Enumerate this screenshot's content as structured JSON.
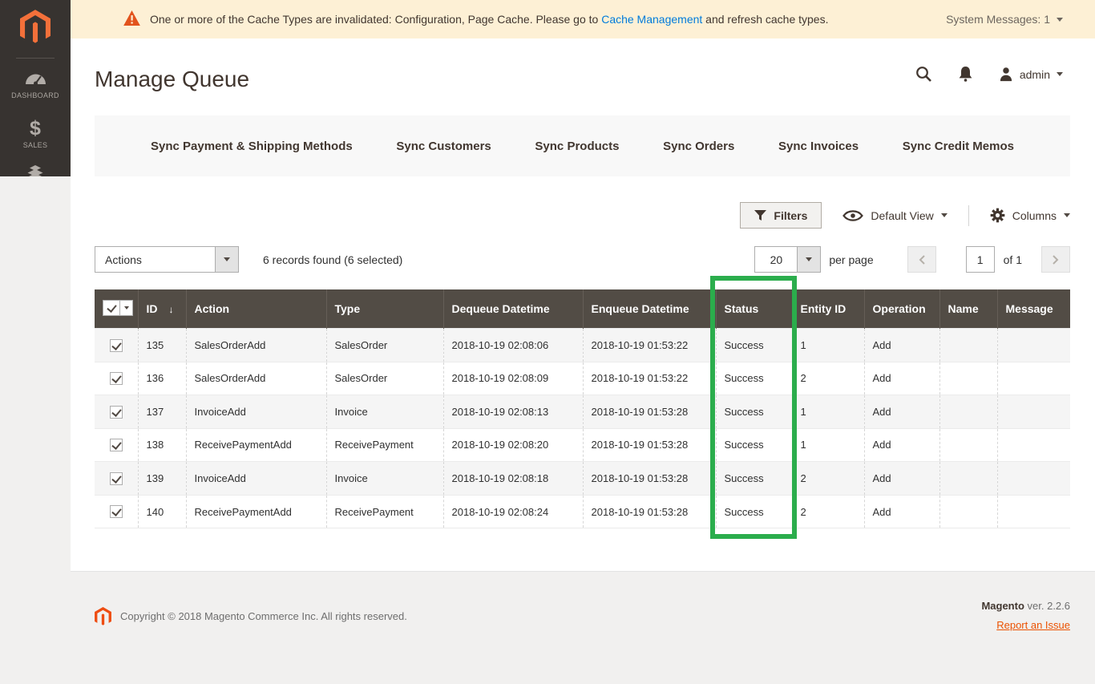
{
  "notice_bar": {
    "message_prefix": "One or more of the Cache Types are invalidated: Configuration, Page Cache. Please go to ",
    "link_text": "Cache Management",
    "message_suffix": " and refresh cache types.",
    "system_messages": "System Messages: 1"
  },
  "sidebar": {
    "items": [
      {
        "label": "DASHBOARD",
        "icon": "dashboard-gauge-icon"
      },
      {
        "label": "SALES",
        "icon": "dollar-icon"
      }
    ]
  },
  "header": {
    "title": "Manage Queue",
    "username": "admin"
  },
  "tabs": [
    {
      "label": "Sync Payment & Shipping Methods"
    },
    {
      "label": "Sync Customers"
    },
    {
      "label": "Sync Products"
    },
    {
      "label": "Sync Orders"
    },
    {
      "label": "Sync Invoices"
    },
    {
      "label": "Sync Credit Memos"
    }
  ],
  "toolbar": {
    "filters_label": "Filters",
    "view_label": "Default View",
    "columns_label": "Columns",
    "actions_label": "Actions",
    "records_summary": "6 records found (6 selected)",
    "per_page_value": "20",
    "per_page_label": "per page",
    "current_page": "1",
    "of_label": "of 1"
  },
  "grid": {
    "sort_icon": "↓",
    "columns": [
      "ID",
      "Action",
      "Type",
      "Dequeue Datetime",
      "Enqueue Datetime",
      "Status",
      "Entity ID",
      "Operation",
      "Name",
      "Message"
    ],
    "rows": [
      {
        "id": "135",
        "action": "SalesOrderAdd",
        "type": "SalesOrder",
        "dequeue": "2018-10-19 02:08:06",
        "enqueue": "2018-10-19 01:53:22",
        "status": "Success",
        "entity_id": "1",
        "operation": "Add",
        "name": "",
        "message": ""
      },
      {
        "id": "136",
        "action": "SalesOrderAdd",
        "type": "SalesOrder",
        "dequeue": "2018-10-19 02:08:09",
        "enqueue": "2018-10-19 01:53:22",
        "status": "Success",
        "entity_id": "2",
        "operation": "Add",
        "name": "",
        "message": ""
      },
      {
        "id": "137",
        "action": "InvoiceAdd",
        "type": "Invoice",
        "dequeue": "2018-10-19 02:08:13",
        "enqueue": "2018-10-19 01:53:28",
        "status": "Success",
        "entity_id": "1",
        "operation": "Add",
        "name": "",
        "message": ""
      },
      {
        "id": "138",
        "action": "ReceivePaymentAdd",
        "type": "ReceivePayment",
        "dequeue": "2018-10-19 02:08:20",
        "enqueue": "2018-10-19 01:53:28",
        "status": "Success",
        "entity_id": "1",
        "operation": "Add",
        "name": "",
        "message": ""
      },
      {
        "id": "139",
        "action": "InvoiceAdd",
        "type": "Invoice",
        "dequeue": "2018-10-19 02:08:18",
        "enqueue": "2018-10-19 01:53:28",
        "status": "Success",
        "entity_id": "2",
        "operation": "Add",
        "name": "",
        "message": ""
      },
      {
        "id": "140",
        "action": "ReceivePaymentAdd",
        "type": "ReceivePayment",
        "dequeue": "2018-10-19 02:08:24",
        "enqueue": "2018-10-19 01:53:28",
        "status": "Success",
        "entity_id": "2",
        "operation": "Add",
        "name": "",
        "message": ""
      }
    ]
  },
  "annotation": {
    "color": "#2bad4c"
  },
  "footer": {
    "copyright": "Copyright © 2018 Magento Commerce Inc. All rights reserved.",
    "brand": "Magento",
    "version": " ver. 2.2.6",
    "report_link": "Report an Issue"
  }
}
